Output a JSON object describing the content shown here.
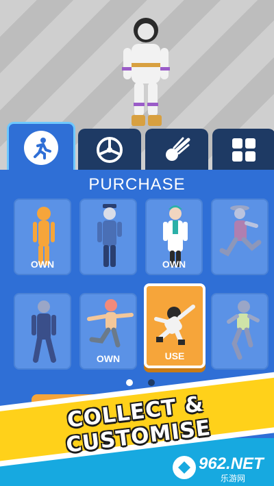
{
  "tabs": [
    {
      "icon": "running-person-icon",
      "active": true
    },
    {
      "icon": "wheel-icon",
      "active": false
    },
    {
      "icon": "comet-icon",
      "active": false
    },
    {
      "icon": "grid-icon",
      "active": false
    }
  ],
  "panel": {
    "title": "PURCHASE"
  },
  "cards": [
    {
      "character": "orange-stickman",
      "badge": "OWN",
      "state": "owned"
    },
    {
      "character": "police-officer",
      "badge": "",
      "state": "locked"
    },
    {
      "character": "doctor",
      "badge": "OWN",
      "state": "owned"
    },
    {
      "character": "cowboy-runner",
      "badge": "",
      "state": "locked"
    },
    {
      "character": "business-suit",
      "badge": "",
      "state": "locked"
    },
    {
      "character": "flying-kick",
      "badge": "OWN",
      "state": "owned"
    },
    {
      "character": "astronaut",
      "badge": "USE",
      "state": "selected"
    },
    {
      "character": "skater",
      "badge": "",
      "state": "locked"
    }
  ],
  "pagination": {
    "current": 1,
    "total": 2
  },
  "banner": {
    "text": "COLLECT & CUSTOMISE"
  },
  "watermark": {
    "main": "962.NET",
    "sub": "乐游网"
  },
  "colors": {
    "panel": "#2f6fd6",
    "tab_dark": "#1e3a64",
    "selected": "#f6a53a",
    "banner": "#ffd11a"
  }
}
